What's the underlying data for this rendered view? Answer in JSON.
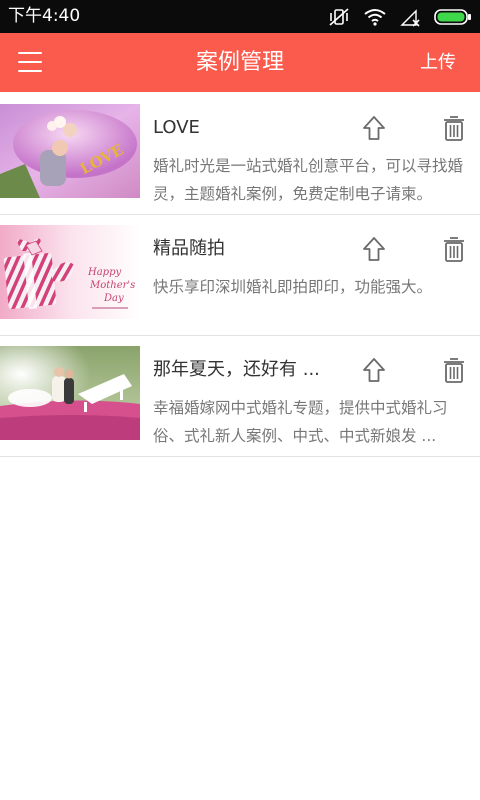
{
  "status_bar": {
    "time": "下午4:40",
    "icons": [
      "vibrate-mute-icon",
      "wifi-icon",
      "no-signal-icon",
      "battery-icon"
    ]
  },
  "header": {
    "title": "案例管理",
    "upload_label": "上传",
    "menu_icon": "hamburger-menu-icon"
  },
  "colors": {
    "header_bg": "#fa5b4c",
    "status_bg": "#0b0b0b",
    "title_text": "#333333",
    "desc_text": "#777777",
    "divider": "#e3e3e3",
    "battery_green": "#3fd84a"
  },
  "cases": [
    {
      "title": "LOVE",
      "description": "婚礼时光是一站式婚礼创意平台，可以寻找婚灵，主题婚礼案例，免费定制电子请柬。",
      "thumbnail": "wedding-couple-pink-gown-photo"
    },
    {
      "title": "精品随拍",
      "description": "快乐享印深圳婚礼即拍即印，功能强大。",
      "thumbnail": "mothers-day-gift-box-photo"
    },
    {
      "title": "那年夏天，还好有 ...",
      "description": "幸福婚嫁网中式婚礼专题，提供中式婚礼习俗、式礼新人案例、中式、中式新娘发 ...",
      "thumbnail": "couple-piano-flower-field-photo"
    }
  ],
  "action_icons": {
    "upload": "arrow-up-icon",
    "delete": "trash-icon"
  }
}
